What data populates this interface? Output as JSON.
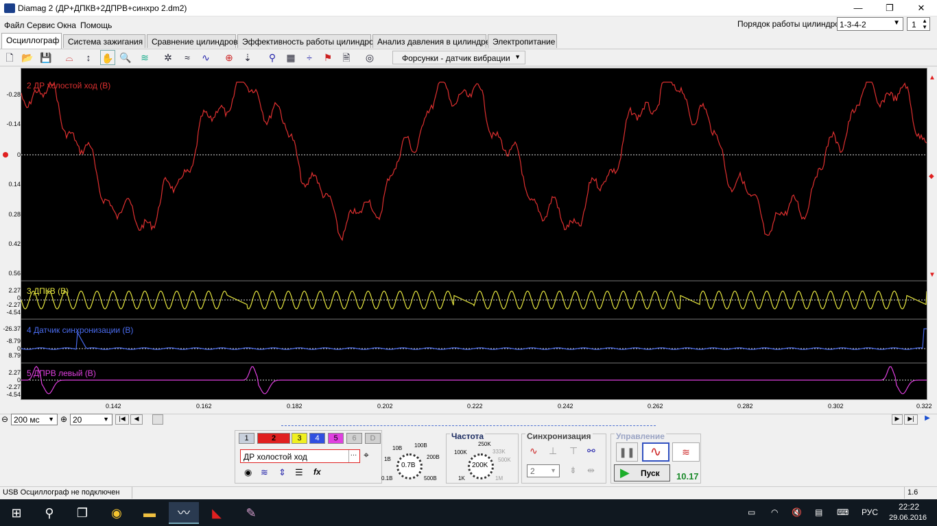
{
  "window": {
    "title": "Diamag 2 (ДР+ДПКВ+2ДПРВ+синхро 2.dm2)",
    "min": "—",
    "max": "❐",
    "close": "✕"
  },
  "menu": [
    "Файл",
    "Сервис",
    "Окна",
    "Помощь"
  ],
  "cylinder_order": {
    "label": "Порядок работы цилиндров",
    "value": "1-3-4-2",
    "cylinder": "1"
  },
  "tabs": [
    "Осциллограф",
    "Система зажигания",
    "Сравнение цилиндров",
    "Эффективность работы цилиндров",
    "Анализ давления в цилиндре",
    "Электропитание"
  ],
  "toolbar": {
    "preset": "Форсунки - датчик вибрации"
  },
  "channels": [
    {
      "title": "2 ДР холостой ход (В)",
      "color": "#e03030",
      "ticks": [
        "-0.28",
        "-0.14",
        "0",
        "0.14",
        "0.28",
        "0.42",
        "0.56"
      ]
    },
    {
      "title": "3 ДПКВ (В)",
      "color": "#e8e840",
      "ticks": [
        "2.27",
        "0",
        "-2.27",
        "-4.54"
      ]
    },
    {
      "title": "4 Датчик синхронизации (В)",
      "color": "#4a6cf0",
      "ticks": [
        "-26.37",
        "-8.79",
        "0",
        "8.79"
      ]
    },
    {
      "title": "5 ДПРВ левый (В)",
      "color": "#e040e0",
      "ticks": [
        "2.27",
        "0",
        "-2.27",
        "-4.54"
      ]
    }
  ],
  "x_ticks": [
    "0.142",
    "0.162",
    "0.182",
    "0.202",
    "0.222",
    "0.242",
    "0.262",
    "0.282",
    "0.302",
    "0.322"
  ],
  "scroll": {
    "timebase": "200 мс",
    "zoom": "20"
  },
  "panel": {
    "channel_buttons": [
      "1",
      "2",
      "3",
      "4",
      "5",
      "6",
      "D"
    ],
    "channel_name": "ДР холостой ход",
    "volts_labels": [
      "10В",
      "100В",
      "1В",
      "200В",
      "0.1В",
      "500В"
    ],
    "volts_value": "0.7В",
    "freq_title": "Частота",
    "freq_labels": [
      "250K",
      "100K",
      "333K",
      "500K",
      "1K",
      "1M"
    ],
    "freq_value": "200K",
    "sync_title": "Синхронизация",
    "sync_channel": "2",
    "control_title": "Управление",
    "start_label": "Пуск",
    "counter": "10.17"
  },
  "status": {
    "text": "USB Осциллограф не подключен",
    "version": "1.6"
  },
  "taskbar": {
    "lang": "РУС",
    "time": "22:22",
    "date": "29.06.2016"
  }
}
